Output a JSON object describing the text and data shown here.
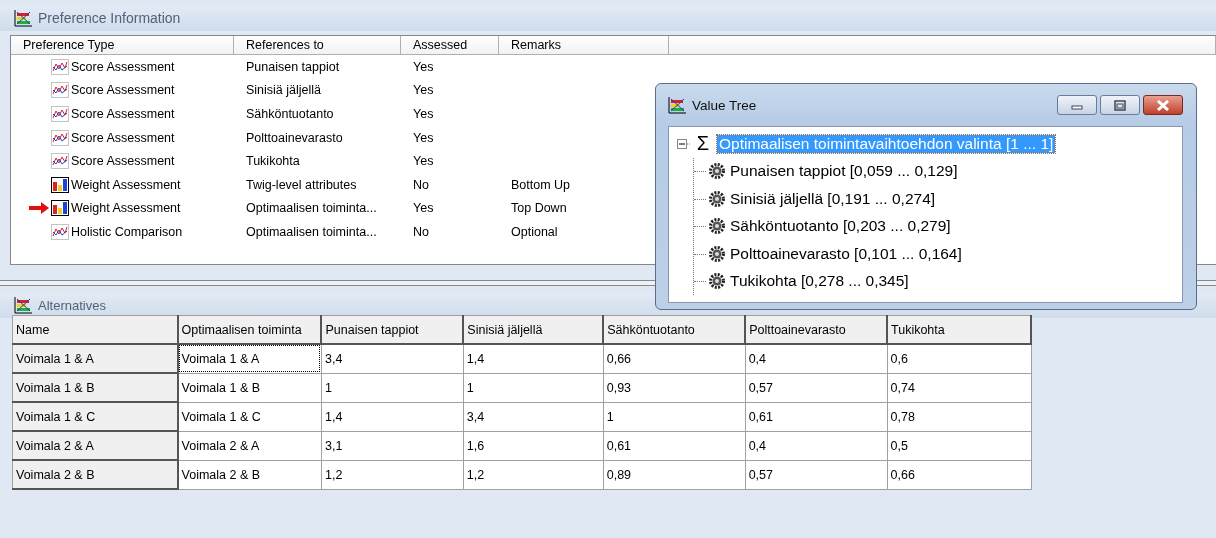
{
  "preference_information": {
    "title": "Preference Information",
    "columns": [
      "Preference Type",
      "References to",
      "Assessed",
      "Remarks"
    ],
    "rows": [
      {
        "kind": "chart",
        "type": "Score Assessment",
        "references": "Punaisen tappiot",
        "assessed": "Yes",
        "current": false
      },
      {
        "kind": "chart",
        "type": "Score Assessment",
        "references": "Sinisiä jäljellä",
        "assessed": "Yes",
        "current": false
      },
      {
        "kind": "chart",
        "type": "Score Assessment",
        "references": "Sähköntuotanto",
        "assessed": "Yes",
        "current": false
      },
      {
        "kind": "chart",
        "type": "Score Assessment",
        "references": "Polttoainevarasto",
        "assessed": "Yes",
        "current": false
      },
      {
        "kind": "chart",
        "type": "Score Assessment",
        "references": "Tukikohta",
        "assessed": "Yes",
        "current": false
      },
      {
        "kind": "bars",
        "type": "Weight Assessment",
        "references": "Twig-level attributes",
        "assessed": "No",
        "remarks": "Bottom Up",
        "current": false
      },
      {
        "kind": "bars",
        "type": "Weight Assessment",
        "references": "Optimaalisen toiminta...",
        "assessed": "Yes",
        "remarks": "Top Down",
        "current": true
      },
      {
        "kind": "chart",
        "type": "Holistic Comparison",
        "references": "Optimaalisen toiminta...",
        "assessed": "No",
        "remarks": "Optional",
        "current": false
      }
    ]
  },
  "value_tree": {
    "title": "Value Tree",
    "root": {
      "symbol": "Σ",
      "label": "Optimaalisen toimintavaihtoehdon valinta [1 ... 1]",
      "expanded": true,
      "selected": true,
      "children": [
        {
          "label": "Punaisen tappiot [0,059 ... 0,129]"
        },
        {
          "label": "Sinisiä jäljellä [0,191 ... 0,274]"
        },
        {
          "label": "Sähköntuotanto [0,203 ... 0,279]"
        },
        {
          "label": "Polttoainevarasto [0,101 ... 0,164]"
        },
        {
          "label": "Tukikohta [0,278 ... 0,345]"
        }
      ]
    }
  },
  "alternatives": {
    "title": "Alternatives",
    "columns": [
      "Name",
      "Optimaalisen toiminta",
      "Punaisen tappiot",
      "Sinisiä jäljellä",
      "Sähköntuotanto",
      "Polttoainevarasto",
      "Tukikohta"
    ],
    "rows": [
      {
        "cells": [
          "Voimala 1 & A",
          "Voimala 1 & A",
          "3,4",
          "1,4",
          "0,66",
          "0,4",
          "0,6"
        ],
        "focused": true
      },
      {
        "cells": [
          "Voimala 1 & B",
          "Voimala 1 & B",
          "1",
          "1",
          "0,93",
          "0,57",
          "0,74"
        ],
        "focused": false
      },
      {
        "cells": [
          "Voimala 1 & C",
          "Voimala 1 & C",
          "1,4",
          "3,4",
          "1",
          "0,61",
          "0,78"
        ],
        "focused": false
      },
      {
        "cells": [
          "Voimala 2 & A",
          "Voimala 2 & A",
          "3,1",
          "1,6",
          "0,61",
          "0,4",
          "0,5"
        ],
        "focused": false
      },
      {
        "cells": [
          "Voimala 2 & B",
          "Voimala 2 & B",
          "1,2",
          "1,2",
          "0,89",
          "0,57",
          "0,66"
        ],
        "focused": false
      }
    ]
  }
}
